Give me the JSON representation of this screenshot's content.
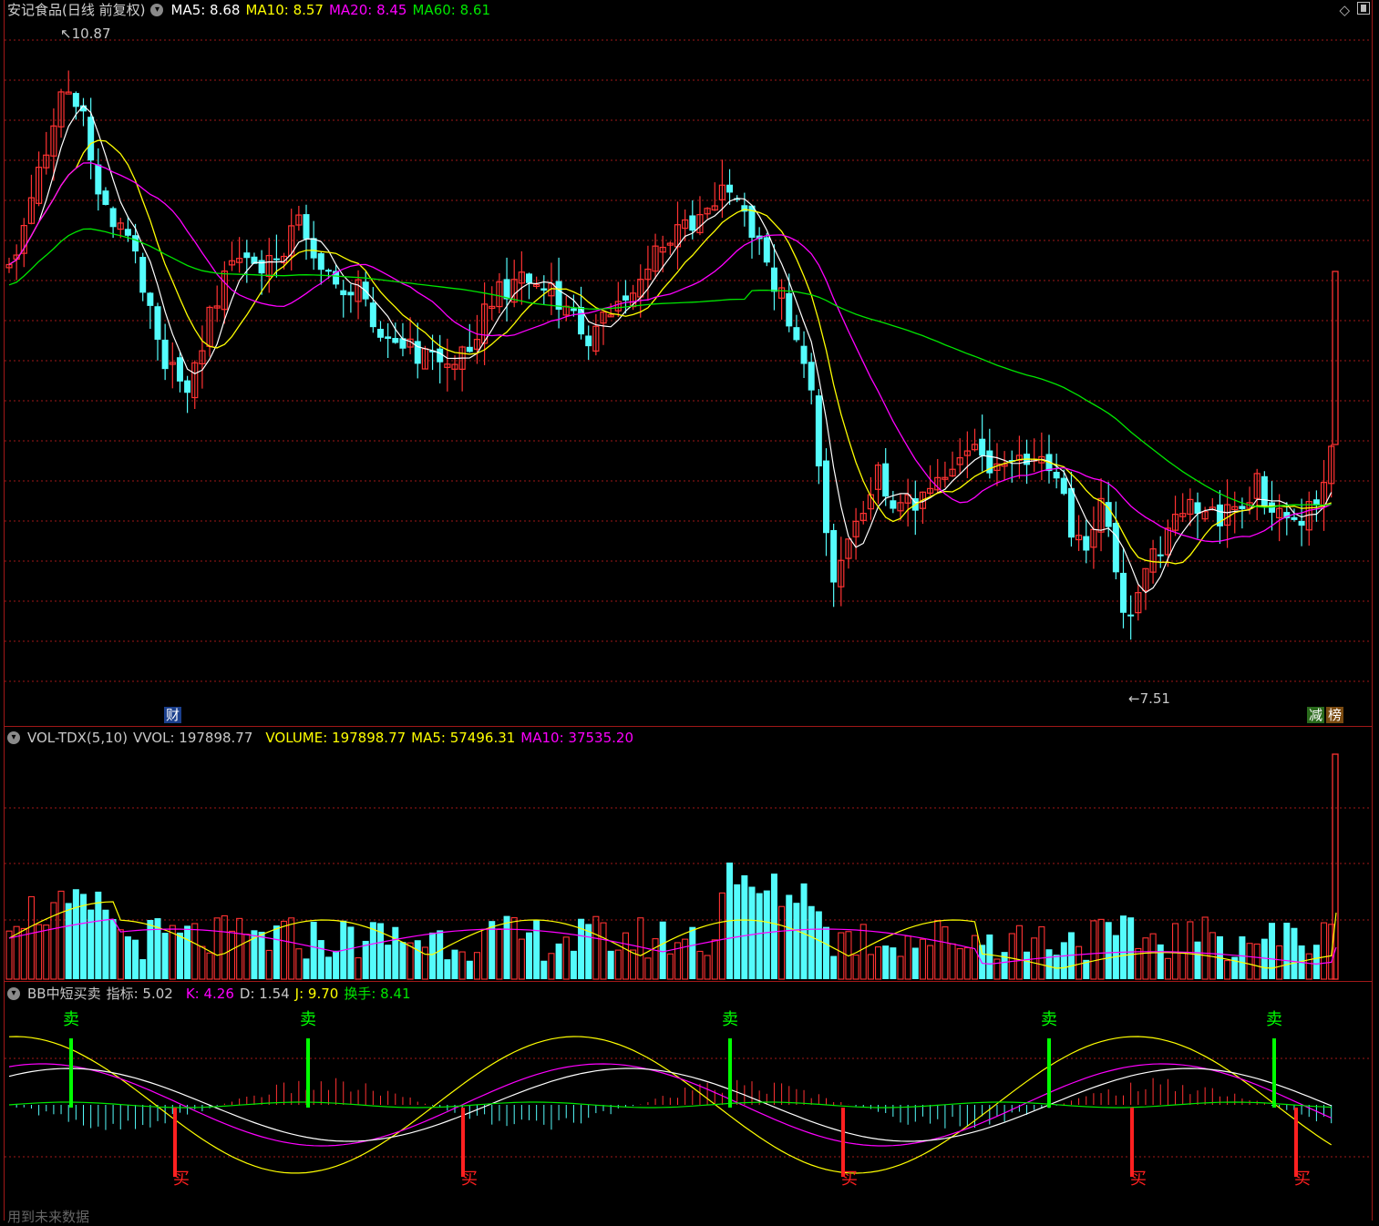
{
  "main_header": {
    "title": "安记食品(日线 前复权)",
    "ma5": "MA5: 8.68",
    "ma10": "MA10: 8.57",
    "ma20": "MA20: 8.45",
    "ma60": "MA60: 8.61"
  },
  "price_marks": {
    "high": "10.87",
    "low": "7.51"
  },
  "badges": {
    "cai": "财",
    "jian": "减",
    "bang": "榜"
  },
  "vol_header": {
    "name": "VOL-TDX(5,10)",
    "vvol": "VVOL: 197898.77",
    "volume": "VOLUME: 197898.77",
    "ma5": "MA5: 57496.31",
    "ma10": "MA10: 37535.20"
  },
  "ind_header": {
    "name": "BB中短买卖",
    "zhibiao": "指标: 5.02",
    "k": "K: 4.26",
    "d": "D: 1.54",
    "j": "J: 9.70",
    "huanshou": "换手: 8.41"
  },
  "signals": {
    "sell": "卖",
    "buy": "买"
  },
  "footer": "用到未来数据",
  "colors": {
    "up": "#ff3232",
    "down": "#54fcfc",
    "ma5": "#ffffff",
    "ma10": "#ffff00",
    "ma20": "#ff00ff",
    "ma60": "#00e600",
    "grid": "#a01818"
  },
  "chart_data": {
    "type": "candlestick",
    "title": "安记食品(日线 前复权)",
    "y_high_mark": 10.87,
    "y_low_mark": 7.51,
    "moving_averages": {
      "MA5": 8.68,
      "MA10": 8.57,
      "MA20": 8.45,
      "MA60": 8.61
    },
    "volume_last": 197898.77,
    "volume_ma5": 57496.31,
    "volume_ma10": 37535.2,
    "indicator": {
      "name": "BB中短买卖",
      "value": 5.02,
      "K": 4.26,
      "D": 1.54,
      "J": 9.7,
      "turnover": 8.41
    },
    "sell_signals": 5,
    "buy_signals": 5
  }
}
